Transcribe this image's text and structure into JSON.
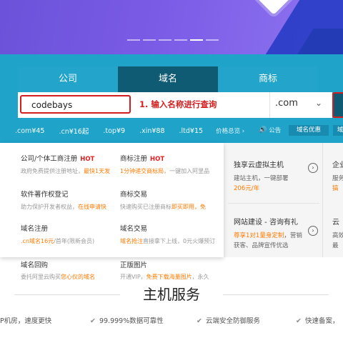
{
  "search": {
    "tabs": [
      {
        "label": "公司"
      },
      {
        "label": "域名"
      },
      {
        "label": "商标"
      }
    ],
    "input_value": "codebays",
    "annotation": "1. 输入名称进行查询",
    "suffix_value": ".com",
    "prices": [
      {
        "tld": ".com",
        "price": "¥45"
      },
      {
        "tld": ".cn",
        "price": "¥16起"
      },
      {
        "tld": ".top",
        "price": "¥9"
      },
      {
        "tld": ".xin",
        "price": "¥88"
      },
      {
        "tld": ".ltd",
        "price": "¥15"
      }
    ],
    "price_total_label": "价格总览",
    "notice_label": "公告",
    "domain_promo_label": "域名优惠",
    "domain_more_label": "域"
  },
  "menu": {
    "items": [
      {
        "title": "公司/个体工商注册",
        "hot": "HOT",
        "desc_pre": "政府免费提供注册地址，",
        "desc_hl": "最快1天发",
        "desc_post": ""
      },
      {
        "title": "商标注册",
        "hot": "HOT",
        "desc_pre": "",
        "desc_hl": "1分钟递交商标局",
        "desc_post": "，一键加入阿里品"
      },
      {
        "title": "软件著作权登记",
        "hot": "",
        "desc_pre": "助力保护开发者权益，",
        "desc_hl": "在线申请快",
        "desc_post": ""
      },
      {
        "title": "商标交易",
        "hot": "",
        "desc_pre": "快速购买已注册商标",
        "desc_hl": "即买即用，免",
        "desc_post": ""
      },
      {
        "title": "域名注册",
        "hot": "",
        "desc_pre": "",
        "desc_hl": ".cn域名16元",
        "desc_post": "/首年(限新会员)"
      },
      {
        "title": "域名交易",
        "hot": "",
        "desc_pre": "",
        "desc_hl": "域名抢注",
        "desc_post": "直接拿下上线，0元火爆预订"
      }
    ],
    "lower_items": [
      {
        "title": "域名回购",
        "desc_pre": "委托阿里云购买",
        "desc_hl": "您心仪的域名",
        "desc_post": ""
      },
      {
        "title": "正版图片",
        "desc_pre": "开通VIP，",
        "desc_hl": "免费下载海量图片",
        "desc_post": "，永久"
      }
    ]
  },
  "cards": [
    {
      "title": "独享云虚拟主机",
      "desc_pre": "建站主机，一键部署",
      "desc_hl": "206元/年",
      "desc_post": ""
    },
    {
      "title": "企业",
      "desc_pre": "服务",
      "desc_hl": "搞",
      "desc_post": ""
    },
    {
      "title": "网站建设 - 咨询有礼",
      "desc_pre": "",
      "desc_hl": "尊享1对1量身定制",
      "desc_post": "，营销获客、品牌宣传优选"
    },
    {
      "title": "云",
      "desc_pre": "高效",
      "desc_hl": "",
      "desc_post": "最"
    }
  ],
  "host": {
    "title": "主机服务",
    "features": [
      "P机房，速度更快",
      "99.999%数据可靠性",
      "云端安全防御服务",
      "快速备案，"
    ]
  },
  "colors": {
    "panel_bg": "#1fa3c9",
    "active_tab": "#0e5b73",
    "annotation_red": "#d21e1e",
    "highlight_orange": "#ff7a00",
    "hot_red": "#e02020"
  }
}
